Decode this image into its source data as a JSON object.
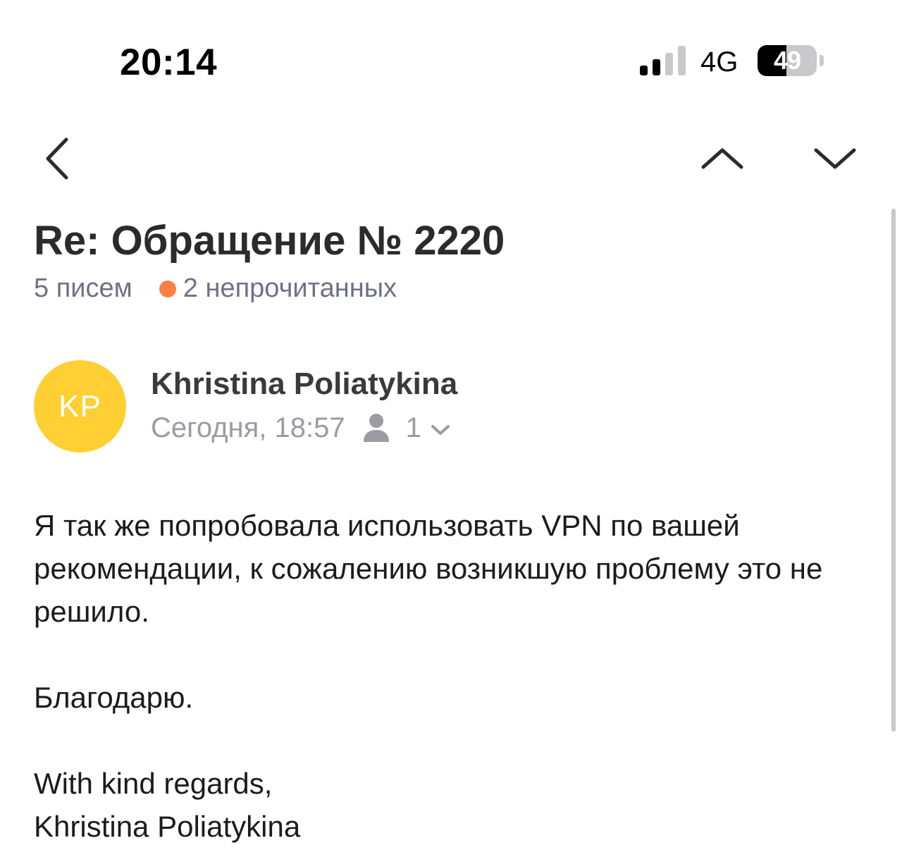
{
  "status_bar": {
    "time": "20:14",
    "network": "4G",
    "battery_percent": "49",
    "battery_level": 0.49,
    "signal_bars_active": 2,
    "signal_bars_total": 4
  },
  "thread": {
    "subject": "Re: Обращение № 2220",
    "message_count": "5 писем",
    "unread_count": "2 непрочитанных"
  },
  "message": {
    "avatar_initials": "KP",
    "sender_name": "Khristina Poliatykina",
    "date": "Сегодня, 18:57",
    "recipient_count": "1",
    "body_paragraph_1": "Я так же попробовала использовать VPN по вашей рекомендации, к сожалению возникшую проблему это не решило.",
    "body_paragraph_2": "Благодарю.",
    "signature_line_1": "With kind regards,",
    "signature_line_2": "Khristina Poliatykina"
  },
  "colors": {
    "avatar_bg": "#ffcf33",
    "unread_dot": "#ff7e45",
    "meta_text": "#6e7284",
    "muted_text": "#9a9ba3"
  },
  "icons": {
    "back": "chevron-left-icon",
    "prev_message": "chevron-up-icon",
    "next_message": "chevron-down-icon",
    "recipients": "person-icon",
    "expand": "chevron-down-small-icon"
  }
}
